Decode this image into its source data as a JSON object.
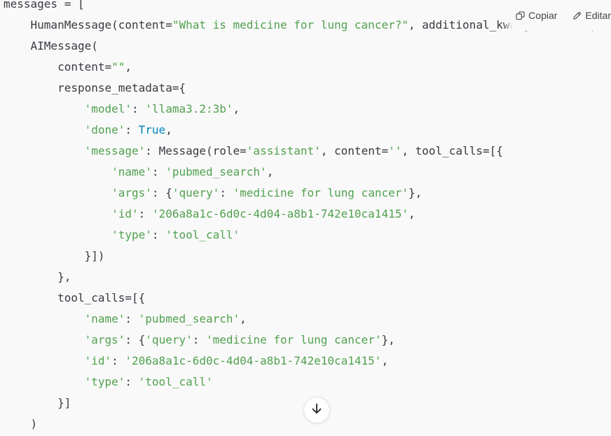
{
  "toolbar": {
    "copy_label": "Copiar",
    "edit_label": "Editar"
  },
  "code_lines": [
    [
      {
        "t": "messages = [",
        "c": ""
      }
    ],
    [
      {
        "t": "    HumanMessage(content=",
        "c": ""
      },
      {
        "t": "\"What is medicine for lung cancer?\"",
        "c": "str"
      },
      {
        "t": ", additional_kwargs={}, response_metadata={}),",
        "c": ""
      }
    ],
    [
      {
        "t": "    AIMessage(",
        "c": ""
      }
    ],
    [
      {
        "t": "        content=",
        "c": ""
      },
      {
        "t": "\"\"",
        "c": "str"
      },
      {
        "t": ",",
        "c": ""
      }
    ],
    [
      {
        "t": "        response_metadata={",
        "c": ""
      }
    ],
    [
      {
        "t": "            ",
        "c": ""
      },
      {
        "t": "'model'",
        "c": "str"
      },
      {
        "t": ": ",
        "c": ""
      },
      {
        "t": "'llama3.2:3b'",
        "c": "str"
      },
      {
        "t": ",",
        "c": ""
      }
    ],
    [
      {
        "t": "            ",
        "c": ""
      },
      {
        "t": "'done'",
        "c": "str"
      },
      {
        "t": ": ",
        "c": ""
      },
      {
        "t": "True",
        "c": "kw"
      },
      {
        "t": ",",
        "c": ""
      }
    ],
    [
      {
        "t": "            ",
        "c": ""
      },
      {
        "t": "'message'",
        "c": "str"
      },
      {
        "t": ": Message(role=",
        "c": ""
      },
      {
        "t": "'assistant'",
        "c": "str"
      },
      {
        "t": ", content=",
        "c": ""
      },
      {
        "t": "''",
        "c": "str"
      },
      {
        "t": ", tool_calls=[{",
        "c": ""
      }
    ],
    [
      {
        "t": "                ",
        "c": ""
      },
      {
        "t": "'name'",
        "c": "str"
      },
      {
        "t": ": ",
        "c": ""
      },
      {
        "t": "'pubmed_search'",
        "c": "str"
      },
      {
        "t": ",",
        "c": ""
      }
    ],
    [
      {
        "t": "                ",
        "c": ""
      },
      {
        "t": "'args'",
        "c": "str"
      },
      {
        "t": ": {",
        "c": ""
      },
      {
        "t": "'query'",
        "c": "str"
      },
      {
        "t": ": ",
        "c": ""
      },
      {
        "t": "'medicine for lung cancer'",
        "c": "str"
      },
      {
        "t": "},",
        "c": ""
      }
    ],
    [
      {
        "t": "                ",
        "c": ""
      },
      {
        "t": "'id'",
        "c": "str"
      },
      {
        "t": ": ",
        "c": ""
      },
      {
        "t": "'206a8a1c-6d0c-4d04-a8b1-742e10ca1415'",
        "c": "str"
      },
      {
        "t": ",",
        "c": ""
      }
    ],
    [
      {
        "t": "                ",
        "c": ""
      },
      {
        "t": "'type'",
        "c": "str"
      },
      {
        "t": ": ",
        "c": ""
      },
      {
        "t": "'tool_call'",
        "c": "str"
      }
    ],
    [
      {
        "t": "            }])",
        "c": ""
      }
    ],
    [
      {
        "t": "        },",
        "c": ""
      }
    ],
    [
      {
        "t": "        tool_calls=[{",
        "c": ""
      }
    ],
    [
      {
        "t": "            ",
        "c": ""
      },
      {
        "t": "'name'",
        "c": "str"
      },
      {
        "t": ": ",
        "c": ""
      },
      {
        "t": "'pubmed_search'",
        "c": "str"
      },
      {
        "t": ",",
        "c": ""
      }
    ],
    [
      {
        "t": "            ",
        "c": ""
      },
      {
        "t": "'args'",
        "c": "str"
      },
      {
        "t": ": {",
        "c": ""
      },
      {
        "t": "'query'",
        "c": "str"
      },
      {
        "t": ": ",
        "c": ""
      },
      {
        "t": "'medicine for lung cancer'",
        "c": "str"
      },
      {
        "t": "},",
        "c": ""
      }
    ],
    [
      {
        "t": "            ",
        "c": ""
      },
      {
        "t": "'id'",
        "c": "str"
      },
      {
        "t": ": ",
        "c": ""
      },
      {
        "t": "'206a8a1c-6d0c-4d04-a8b1-742e10ca1415'",
        "c": "str"
      },
      {
        "t": ",",
        "c": ""
      }
    ],
    [
      {
        "t": "            ",
        "c": ""
      },
      {
        "t": "'type'",
        "c": "str"
      },
      {
        "t": ": ",
        "c": ""
      },
      {
        "t": "'tool_call'",
        "c": "str"
      }
    ],
    [
      {
        "t": "        }]",
        "c": ""
      }
    ],
    [
      {
        "t": "    )",
        "c": ""
      }
    ]
  ],
  "icons": {
    "copy": "copy-icon",
    "edit": "pencil-icon",
    "scroll": "arrow-down-icon"
  },
  "colors": {
    "background": "#f9f9f9",
    "text": "#383a42",
    "string": "#50a14f",
    "keyword": "#0184bc"
  }
}
